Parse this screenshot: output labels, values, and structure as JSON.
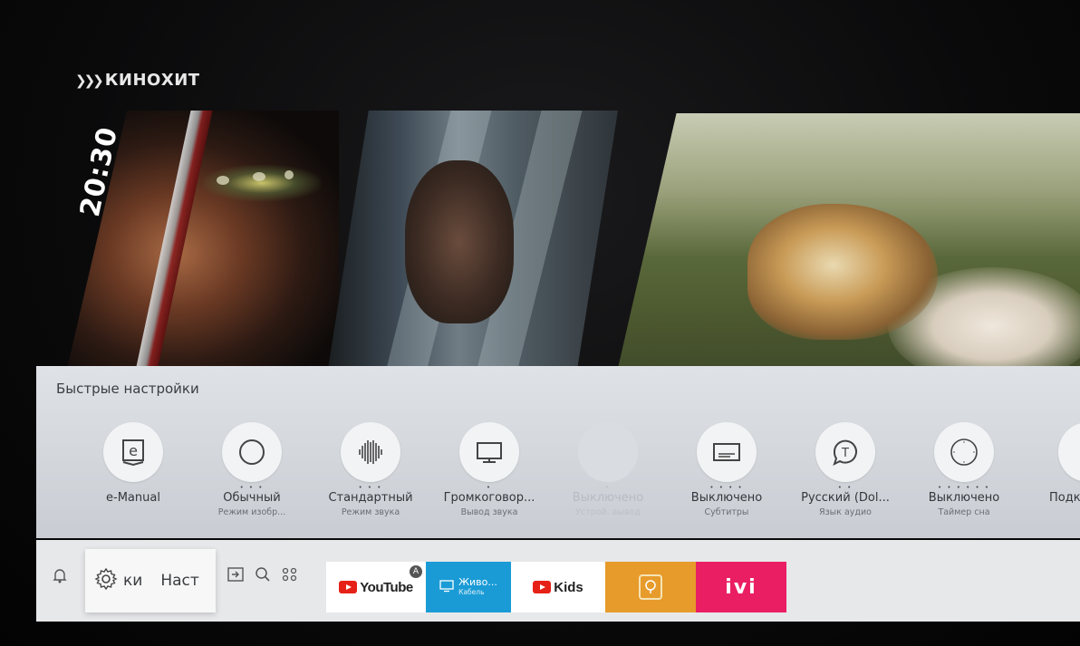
{
  "channel": {
    "name": "КИНОХИТ",
    "clock": "20:30"
  },
  "quick_settings": {
    "title": "Быстрые настройки",
    "items": [
      {
        "icon": "e-manual-icon",
        "label": "e-Manual",
        "sub": "",
        "dots": ""
      },
      {
        "icon": "circle-icon",
        "label": "Обычный",
        "sub": "Режим изобр...",
        "dots": "• • •"
      },
      {
        "icon": "sound-wave-icon",
        "label": "Стандартный",
        "sub": "Режим звука",
        "dots": "• • •"
      },
      {
        "icon": "tv-speaker-icon",
        "label": "Громкоговор...",
        "sub": "Вывод звука",
        "dots": "•"
      },
      {
        "icon": "disabled-icon",
        "label": "Выключено",
        "sub": "Устрой. вывод",
        "dots": "•"
      },
      {
        "icon": "subtitles-icon",
        "label": "Выключено",
        "sub": "Субтитры",
        "dots": "• • • •"
      },
      {
        "icon": "audio-language-icon",
        "label": "Русский (Dol...",
        "sub": "Язык аудио",
        "dots": "• •"
      },
      {
        "icon": "clock-timer-icon",
        "label": "Выключено",
        "sub": "Таймер сна",
        "dots": "• • • • • •"
      },
      {
        "icon": "partial-icon",
        "label": "Подк",
        "sub": "",
        "dots": ""
      }
    ]
  },
  "home_bar": {
    "settings_label_left": "ки",
    "settings_label_right": "Наст",
    "apps": {
      "youtube": "YouTube",
      "youtube_badge": "A",
      "live_title": "Живо...",
      "live_sub": "Кабель",
      "kids": "Kids",
      "ivi": "ivi"
    }
  },
  "colors": {
    "panel_bg": "#dfe2e6",
    "homebar_bg": "#e7e8ea",
    "live_tile": "#1a9bd6",
    "app_tile": "#e79b2b",
    "ivi_tile": "#ea1e63",
    "youtube_red": "#e62117"
  }
}
